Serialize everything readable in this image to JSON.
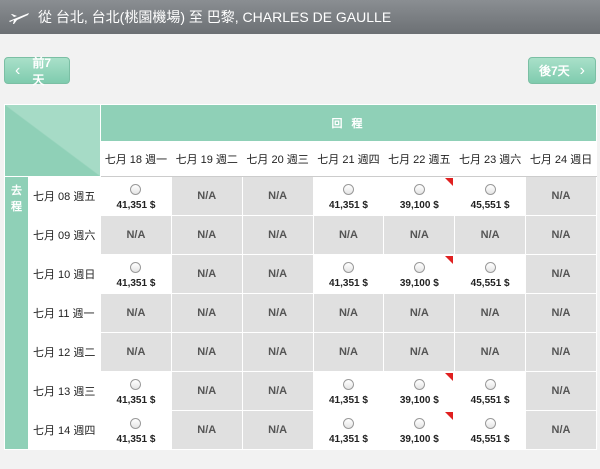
{
  "header": {
    "from_label": "從",
    "origin": "台北, 台北(桃園機場)",
    "to_label": "至",
    "destination": "巴黎, CHARLES DE GAULLE"
  },
  "nav": {
    "prev_label": "前7天",
    "next_label": "後7天"
  },
  "grid": {
    "return_label": "回 程",
    "outbound_label": "去程",
    "return_dates": [
      "七月 18 週一",
      "七月 19 週二",
      "七月 20 週三",
      "七月 21 週四",
      "七月 22 週五",
      "七月 23 週六",
      "七月 24 週日"
    ],
    "rows": [
      {
        "date": "七月 08 週五",
        "cells": [
          "41,351 $",
          "N/A",
          "N/A",
          "41,351 $",
          "39,100 $",
          "45,551 $",
          "N/A"
        ],
        "flags": [
          false,
          false,
          false,
          false,
          true,
          false,
          false
        ]
      },
      {
        "date": "七月 09 週六",
        "cells": [
          "N/A",
          "N/A",
          "N/A",
          "N/A",
          "N/A",
          "N/A",
          "N/A"
        ],
        "flags": [
          false,
          false,
          false,
          false,
          false,
          false,
          false
        ]
      },
      {
        "date": "七月 10 週日",
        "cells": [
          "41,351 $",
          "N/A",
          "N/A",
          "41,351 $",
          "39,100 $",
          "45,551 $",
          "N/A"
        ],
        "flags": [
          false,
          false,
          false,
          false,
          true,
          false,
          false
        ]
      },
      {
        "date": "七月 11 週一",
        "cells": [
          "N/A",
          "N/A",
          "N/A",
          "N/A",
          "N/A",
          "N/A",
          "N/A"
        ],
        "flags": [
          false,
          false,
          false,
          false,
          false,
          false,
          false
        ]
      },
      {
        "date": "七月 12 週二",
        "cells": [
          "N/A",
          "N/A",
          "N/A",
          "N/A",
          "N/A",
          "N/A",
          "N/A"
        ],
        "flags": [
          false,
          false,
          false,
          false,
          false,
          false,
          false
        ]
      },
      {
        "date": "七月 13 週三",
        "cells": [
          "41,351 $",
          "N/A",
          "N/A",
          "41,351 $",
          "39,100 $",
          "45,551 $",
          "N/A"
        ],
        "flags": [
          false,
          false,
          false,
          false,
          true,
          false,
          false
        ]
      },
      {
        "date": "七月 14 週四",
        "cells": [
          "41,351 $",
          "N/A",
          "N/A",
          "41,351 $",
          "39,100 $",
          "45,551 $",
          "N/A"
        ],
        "flags": [
          false,
          false,
          false,
          false,
          true,
          false,
          false
        ]
      }
    ]
  },
  "colors": {
    "accent": "#8fd0b7",
    "na_bg": "#e0e0e0",
    "flag": "#e02020",
    "topbar": "#7a7e82"
  },
  "icons": {
    "plane": "airplane-icon",
    "prev": "chevron-left-icon",
    "next": "chevron-right-icon",
    "flag": "lowest-fare-flag"
  }
}
